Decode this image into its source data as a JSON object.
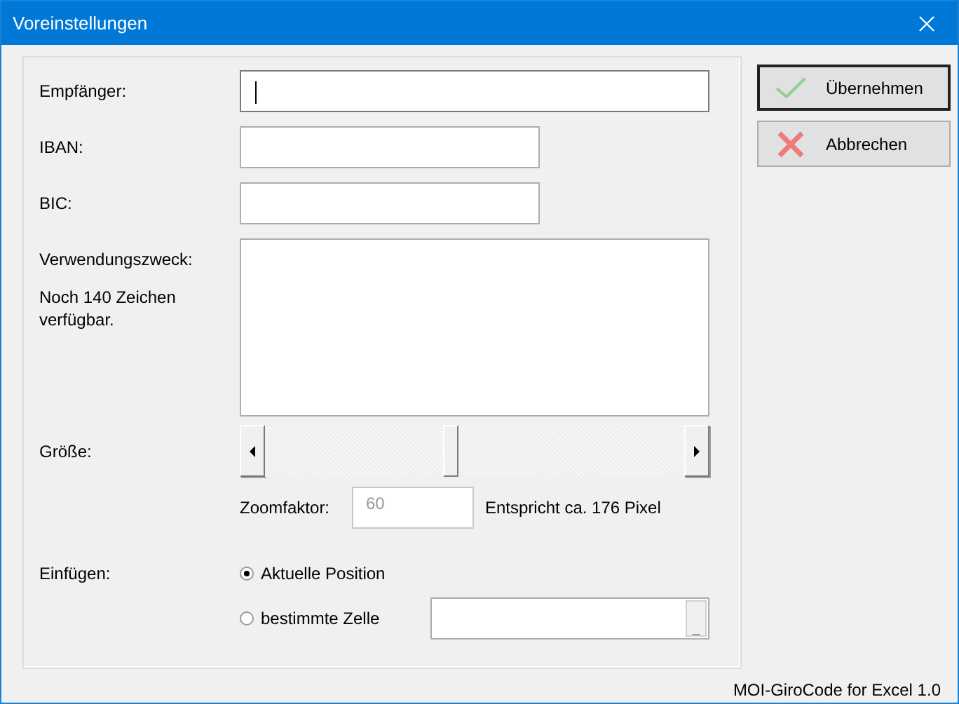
{
  "window": {
    "title": "Voreinstellungen"
  },
  "form": {
    "recipient": {
      "label": "Empfänger:",
      "focused": true
    },
    "iban": {
      "label": "IBAN:"
    },
    "bic": {
      "label": "BIC:"
    },
    "purpose": {
      "label": "Verwendungszweck:",
      "remaining": "Noch 140 Zeichen verfügbar."
    },
    "size": {
      "label": "Größe:",
      "level": 0.44
    },
    "zoom": {
      "label": "Zoomfaktor:",
      "value": "60",
      "disabled": true,
      "note": "Entspricht ca. 176 Pixel"
    },
    "insert": {
      "label": "Einfügen:",
      "options": [
        {
          "label": "Aktuelle Position",
          "selected": true
        },
        {
          "label": "bestimmte Zelle",
          "selected": false
        }
      ],
      "cell_button": "_"
    }
  },
  "buttons": [
    {
      "kind": "ok",
      "label": "Übernehmen",
      "default": true
    },
    {
      "kind": "cancel",
      "label": "Abbrechen",
      "default": false
    }
  ],
  "status_bar": "MOI-GiroCode for Excel 1.0"
}
